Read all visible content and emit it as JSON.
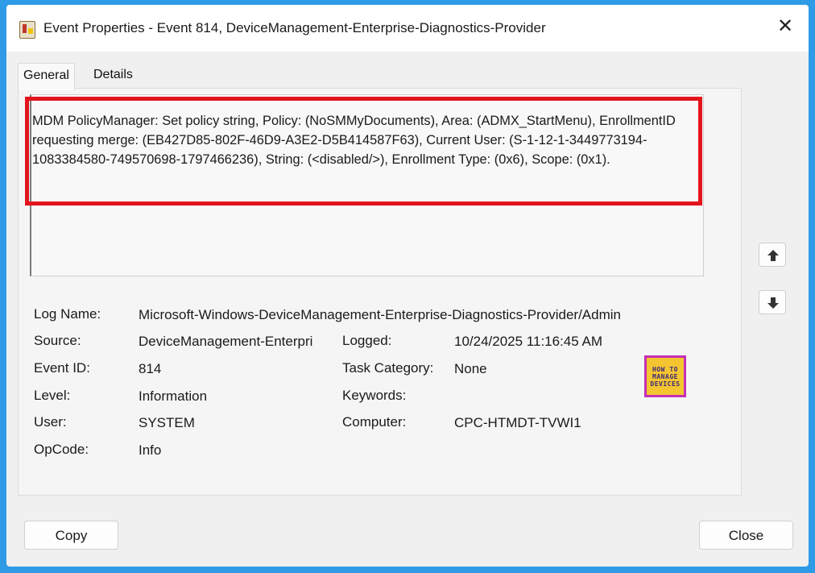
{
  "window": {
    "title": "Event Properties - Event 814, DeviceManagement-Enterprise-Diagnostics-Provider"
  },
  "tabs": [
    {
      "label": "General",
      "active": true
    },
    {
      "label": "Details",
      "active": false
    }
  ],
  "description": "MDM PolicyManager: Set policy string, Policy: (NoSMMyDocuments), Area: (ADMX_StartMenu), EnrollmentID requesting merge: (EB427D85-802F-46D9-A3E2-D5B414587F63), Current User: (S-1-12-1-3449773194-1083384580-749570698-1797466236), String: (<disabled/>), Enrollment Type: (0x6), Scope: (0x1).",
  "fields": {
    "log_name": {
      "label": "Log Name:",
      "value": "Microsoft-Windows-DeviceManagement-Enterprise-Diagnostics-Provider/Admin"
    },
    "source": {
      "label": "Source:",
      "value": "DeviceManagement-Enterpri"
    },
    "logged": {
      "label": "Logged:",
      "value": "10/24/2025 11:16:45 AM"
    },
    "event_id": {
      "label": "Event ID:",
      "value": "814"
    },
    "task_category": {
      "label": "Task Category:",
      "value": "None"
    },
    "level": {
      "label": "Level:",
      "value": "Information"
    },
    "keywords": {
      "label": "Keywords:",
      "value": ""
    },
    "user": {
      "label": "User:",
      "value": "SYSTEM"
    },
    "computer": {
      "label": "Computer:",
      "value": "CPC-HTMDT-TVWI1"
    },
    "opcode": {
      "label": "OpCode:",
      "value": "Info"
    }
  },
  "logo": {
    "line1": "HOW TO",
    "line2": "MANAGE",
    "line3": "DEVICES"
  },
  "nav": {
    "up_icon": "arrow-up-icon",
    "down_icon": "arrow-down-icon"
  },
  "buttons": {
    "copy": "Copy",
    "close": "Close"
  },
  "colors": {
    "highlight": "#e3141c",
    "background": "#2f9be6",
    "logo_bg": "#f4c431",
    "logo_border": "#c52fb5"
  }
}
